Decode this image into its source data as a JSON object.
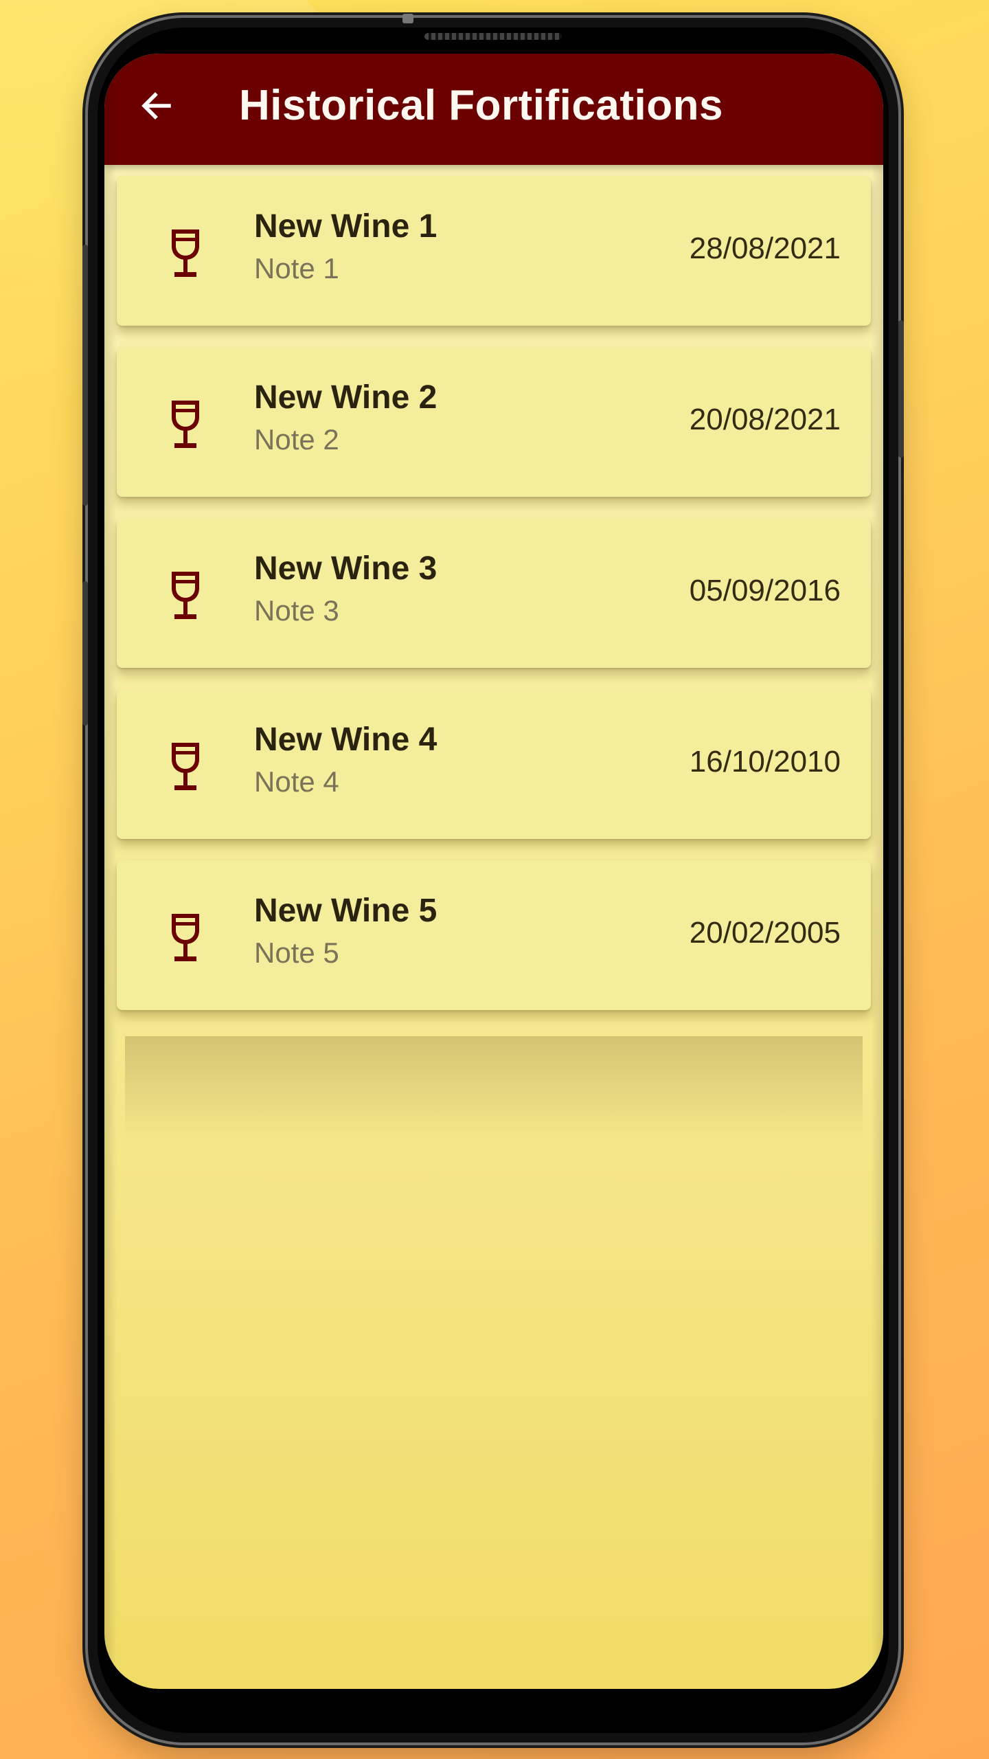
{
  "app_bar": {
    "title": "Historical Fortifications",
    "back_icon": "arrow-left-icon",
    "background_color": "#6b0000"
  },
  "wines": [
    {
      "name": "New Wine 1",
      "note": "Note 1",
      "date": "28/08/2021",
      "icon": "wine-glass-icon"
    },
    {
      "name": "New Wine 2",
      "note": "Note 2",
      "date": "20/08/2021",
      "icon": "wine-glass-icon"
    },
    {
      "name": "New Wine 3",
      "note": "Note 3",
      "date": "05/09/2016",
      "icon": "wine-glass-icon"
    },
    {
      "name": "New Wine 4",
      "note": "Note 4",
      "date": "16/10/2010",
      "icon": "wine-glass-icon"
    },
    {
      "name": "New Wine 5",
      "note": "Note 5",
      "date": "20/02/2005",
      "icon": "wine-glass-icon"
    }
  ],
  "colors": {
    "accent": "#6b0000",
    "card_background": "#f4ed9c",
    "screen_background": "#f8ec9e"
  }
}
